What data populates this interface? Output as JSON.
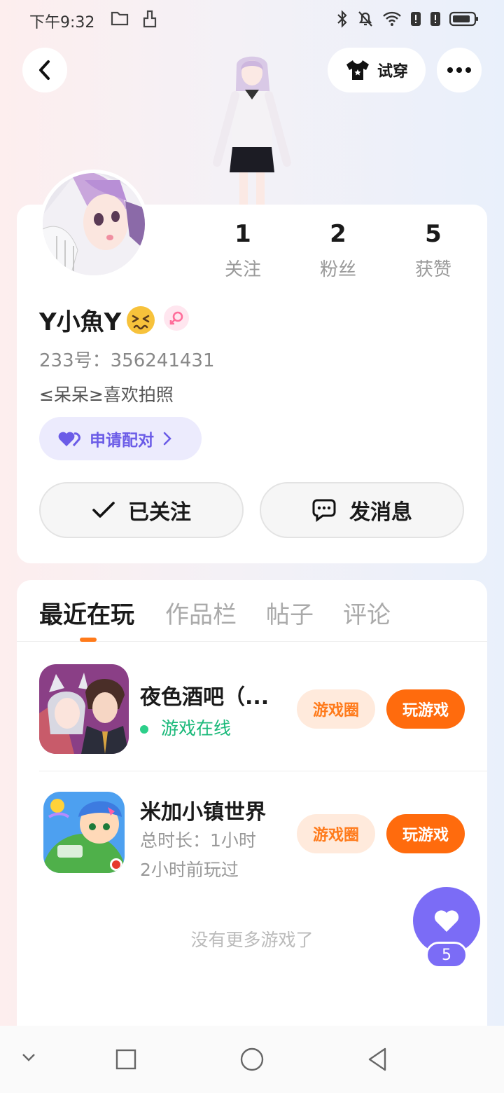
{
  "status_bar": {
    "time": "下午9:32"
  },
  "header": {
    "back_icon": "chevron-left-icon",
    "tryon_label": "试穿",
    "more_icon": "more-dots-icon"
  },
  "profile": {
    "stats": [
      {
        "value": "1",
        "label": "关注"
      },
      {
        "value": "2",
        "label": "粉丝"
      },
      {
        "value": "5",
        "label": "获赞"
      }
    ],
    "username": "Y小魚Y",
    "gender": "female",
    "uid": "233号：356241431",
    "bio": "≤呆呆≥喜欢拍照",
    "pair_label": "申请配对",
    "follow_label": "已关注",
    "message_label": "发消息"
  },
  "tabs": [
    {
      "label": "最近在玩",
      "active": true
    },
    {
      "label": "作品栏",
      "active": false
    },
    {
      "label": "帖子",
      "active": false
    },
    {
      "label": "评论",
      "active": false
    }
  ],
  "games": [
    {
      "title": "夜色酒吧（...",
      "status": "游戏在线",
      "circle_label": "游戏圈",
      "play_label": "玩游戏"
    },
    {
      "title": "米加小镇世界",
      "duration": "总时长：1小时",
      "last_played": "2小时前玩过",
      "circle_label": "游戏圈",
      "play_label": "玩游戏"
    }
  ],
  "no_more_text": "没有更多游戏了",
  "like_fab": {
    "count": "5"
  },
  "colors": {
    "accent_orange": "#ff6b0d",
    "accent_purple": "#7b6cf6",
    "online_green": "#1bb97a"
  }
}
